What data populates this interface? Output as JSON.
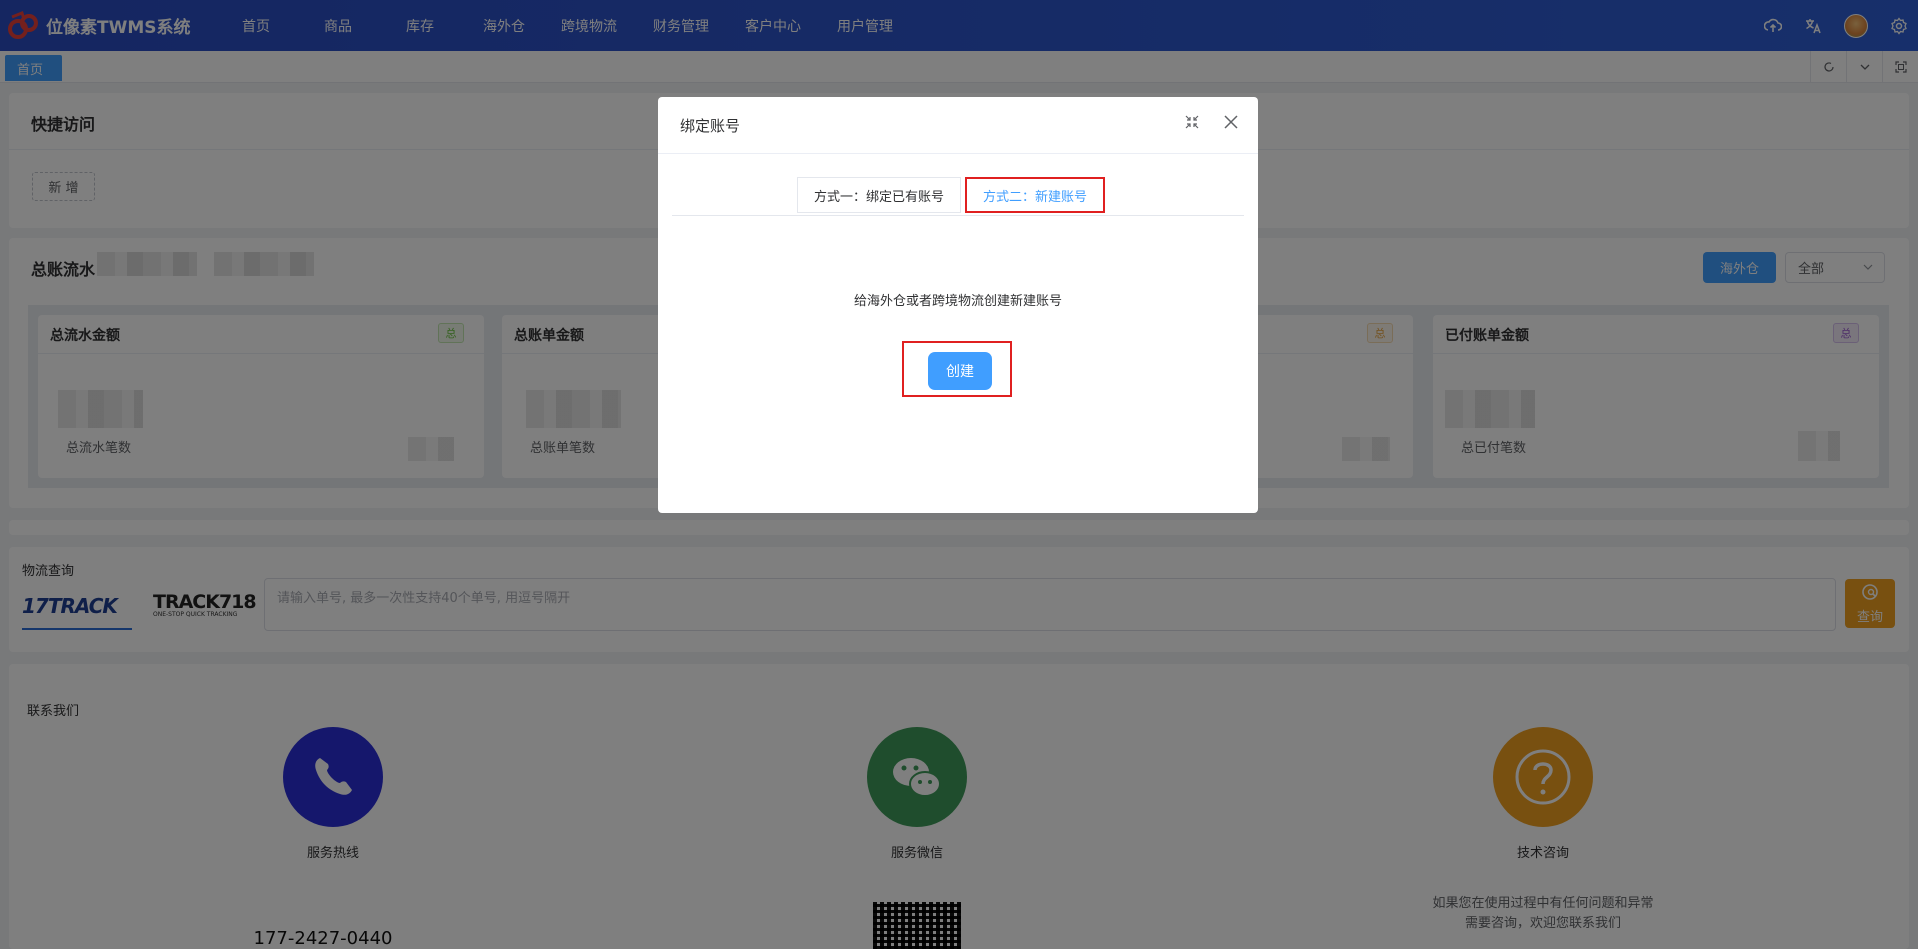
{
  "app": {
    "title": "位像素TWMS系统"
  },
  "menu": [
    {
      "label": "首页"
    },
    {
      "label": "商品"
    },
    {
      "label": "库存"
    },
    {
      "label": "海外仓"
    },
    {
      "label": "跨境物流"
    },
    {
      "label": "财务管理"
    },
    {
      "label": "客户中心"
    },
    {
      "label": "用户管理"
    }
  ],
  "tabs_bar": {
    "home": "首页"
  },
  "quick_access": {
    "title": "快捷访问",
    "add_label": "新 增"
  },
  "ledger": {
    "title": "总账流水",
    "warehouse_btn": "海外仓",
    "filter_value": "全部",
    "cards": [
      {
        "title": "总流水金额",
        "badge": "总",
        "sub": "总流水笔数"
      },
      {
        "title": "总账单金额",
        "sub": "总账单笔数"
      },
      {
        "badge": "总"
      },
      {
        "title": "已付账单金额",
        "badge": "总",
        "sub": "总已付笔数"
      }
    ]
  },
  "logistics": {
    "title": "物流查询",
    "logo1": "17TRACK",
    "logo2": "TRACK718",
    "logo2_sub": "ONE-STOP QUICK TRACKING",
    "placeholder": "请输入单号, 最多一次性支持40个单号, 用逗号隔开",
    "search_label": "查询"
  },
  "contact": {
    "title": "联系我们",
    "hotline_label": "服务热线",
    "phone": "177-2427-0440",
    "wechat_label": "服务微信",
    "tech_label": "技术咨询",
    "tech_desc1": "如果您在使用过程中有任何问题和异常",
    "tech_desc2": "需要咨询，欢迎您联系我们"
  },
  "dialog": {
    "title": "绑定账号",
    "tab1": "方式一：绑定已有账号",
    "tab2": "方式二：新建账号",
    "desc": "给海外仓或者跨境物流创建新建账号",
    "create_label": "创建"
  }
}
